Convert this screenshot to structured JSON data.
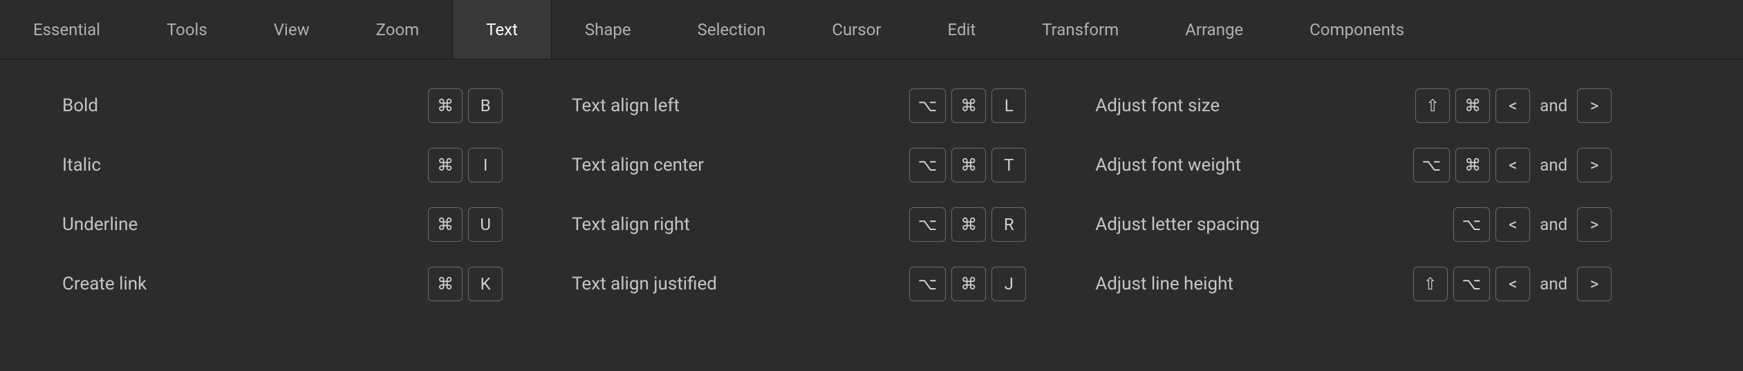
{
  "tabs": [
    {
      "id": "essential",
      "label": "Essential",
      "active": false
    },
    {
      "id": "tools",
      "label": "Tools",
      "active": false
    },
    {
      "id": "view",
      "label": "View",
      "active": false
    },
    {
      "id": "zoom",
      "label": "Zoom",
      "active": false
    },
    {
      "id": "text",
      "label": "Text",
      "active": true
    },
    {
      "id": "shape",
      "label": "Shape",
      "active": false
    },
    {
      "id": "selection",
      "label": "Selection",
      "active": false
    },
    {
      "id": "cursor",
      "label": "Cursor",
      "active": false
    },
    {
      "id": "edit",
      "label": "Edit",
      "active": false
    },
    {
      "id": "transform",
      "label": "Transform",
      "active": false
    },
    {
      "id": "arrange",
      "label": "Arrange",
      "active": false
    },
    {
      "id": "components",
      "label": "Components",
      "active": false
    }
  ],
  "joinWord": "and",
  "columns": [
    [
      {
        "label": "Bold",
        "keysA": [
          "⌘",
          "B"
        ]
      },
      {
        "label": "Italic",
        "keysA": [
          "⌘",
          "I"
        ]
      },
      {
        "label": "Underline",
        "keysA": [
          "⌘",
          "U"
        ]
      },
      {
        "label": "Create link",
        "keysA": [
          "⌘",
          "K"
        ]
      }
    ],
    [
      {
        "label": "Text align left",
        "keysA": [
          "⌥",
          "⌘",
          "L"
        ]
      },
      {
        "label": "Text align center",
        "keysA": [
          "⌥",
          "⌘",
          "T"
        ]
      },
      {
        "label": "Text align right",
        "keysA": [
          "⌥",
          "⌘",
          "R"
        ]
      },
      {
        "label": "Text align justified",
        "keysA": [
          "⌥",
          "⌘",
          "J"
        ]
      }
    ],
    [
      {
        "label": "Adjust font size",
        "keysA": [
          "⇧",
          "⌘",
          "<"
        ],
        "keysB": [
          ">"
        ]
      },
      {
        "label": "Adjust font weight",
        "keysA": [
          "⌥",
          "⌘",
          "<"
        ],
        "keysB": [
          ">"
        ]
      },
      {
        "label": "Adjust letter spacing",
        "keysA": [
          "⌥",
          "<"
        ],
        "keysB": [
          ">"
        ]
      },
      {
        "label": "Adjust line height",
        "keysA": [
          "⇧",
          "⌥",
          "<"
        ],
        "keysB": [
          ">"
        ]
      }
    ]
  ]
}
